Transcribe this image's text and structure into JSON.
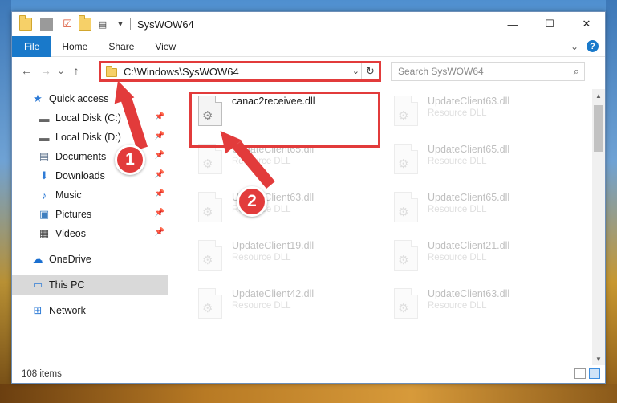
{
  "window": {
    "title": "SysWOW64",
    "minimize": "—",
    "maximize": "☐",
    "close": "✕"
  },
  "ribbon": {
    "tabs": [
      "File",
      "Home",
      "Share",
      "View"
    ],
    "collapse": "⌄",
    "help": "?"
  },
  "nav": {
    "back": "←",
    "forward": "→",
    "recent": "⌄",
    "up": "↑",
    "address": "C:\\Windows\\SysWOW64",
    "search_placeholder": "Search SysWOW64"
  },
  "sidebar": {
    "items": [
      {
        "label": "Quick access",
        "icon": "star-icon"
      },
      {
        "label": "Local Disk (C:)",
        "icon": "drive-icon",
        "pinned": true
      },
      {
        "label": "Local Disk (D:)",
        "icon": "drive-icon",
        "pinned": true
      },
      {
        "label": "Documents",
        "icon": "documents-icon",
        "pinned": true
      },
      {
        "label": "Downloads",
        "icon": "download-icon",
        "pinned": true
      },
      {
        "label": "Music",
        "icon": "music-icon",
        "pinned": true
      },
      {
        "label": "Pictures",
        "icon": "pictures-icon",
        "pinned": true
      },
      {
        "label": "Videos",
        "icon": "videos-icon",
        "pinned": true
      },
      {
        "label": "OneDrive",
        "icon": "cloud-icon"
      },
      {
        "label": "This PC",
        "icon": "computer-icon",
        "selected": true
      },
      {
        "label": "Network",
        "icon": "network-icon"
      }
    ]
  },
  "files": [
    {
      "name": "canac2receivee.dll",
      "type": "",
      "highlight": true
    },
    {
      "name": "UpdateClient63.dll",
      "type": "Resource DLL"
    },
    {
      "name": "UpdateClient65.dll",
      "type": "Resource DLL"
    },
    {
      "name": "UpdateClient65.dll",
      "type": "Resource DLL"
    },
    {
      "name": "UpdateClient63.dll",
      "type": "Resource DLL"
    },
    {
      "name": "UpdateClient65.dll",
      "type": "Resource DLL"
    },
    {
      "name": "UpdateClient19.dll",
      "type": "Resource DLL"
    },
    {
      "name": "UpdateClient21.dll",
      "type": "Resource DLL"
    },
    {
      "name": "UpdateClient42.dll",
      "type": "Resource DLL"
    },
    {
      "name": "UpdateClient63.dll",
      "type": "Resource DLL"
    }
  ],
  "status": {
    "items": "108 items"
  },
  "annotations": {
    "step1": "1",
    "step2": "2",
    "color": "#e23b3b"
  }
}
